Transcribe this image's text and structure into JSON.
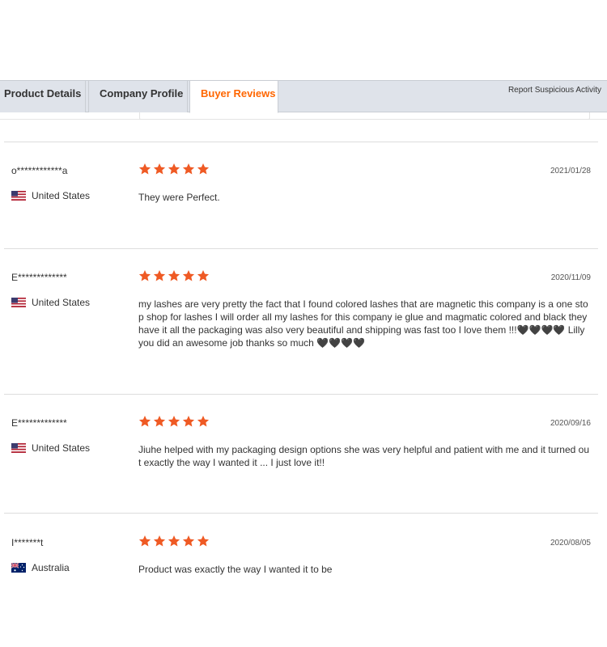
{
  "tabs": {
    "product_details": "Product Details",
    "company_profile": "Company Profile",
    "buyer_reviews": "Buyer Reviews",
    "report": "Report Suspicious Activity"
  },
  "colors": {
    "accent": "#ff6600",
    "star": "#ef5a24",
    "tab_bg": "#dfe3ea"
  },
  "reviews": [
    {
      "reviewer": "o************a",
      "country": "United States",
      "flag": "us-flag-icon",
      "rating": 5,
      "date": "2021/01/28",
      "text": "They were Perfect."
    },
    {
      "reviewer": "E*************",
      "country": "United States",
      "flag": "us-flag-icon",
      "rating": 5,
      "date": "2020/11/09",
      "text": "my lashes are very pretty the fact that I found colored lashes that are magnetic this company is a one stop shop for lashes I will order all my lashes for this company ie glue and magmatic colored and black they have it all the packaging was also very beautiful and shipping was fast too I love them !!!🖤🖤🖤🖤 Lilly you did an awesome job thanks so much 🖤🖤🖤🖤"
    },
    {
      "reviewer": "E*************",
      "country": "United States",
      "flag": "us-flag-icon",
      "rating": 5,
      "date": "2020/09/16",
      "text": "Jiuhe helped with my packaging design options she was very helpful and patient with me and it turned out exactly the way I wanted it ... I just love it!!"
    },
    {
      "reviewer": "I*******t",
      "country": "Australia",
      "flag": "au-flag-icon",
      "rating": 5,
      "date": "2020/08/05",
      "text": "Product was exactly the way I wanted it to be"
    }
  ]
}
